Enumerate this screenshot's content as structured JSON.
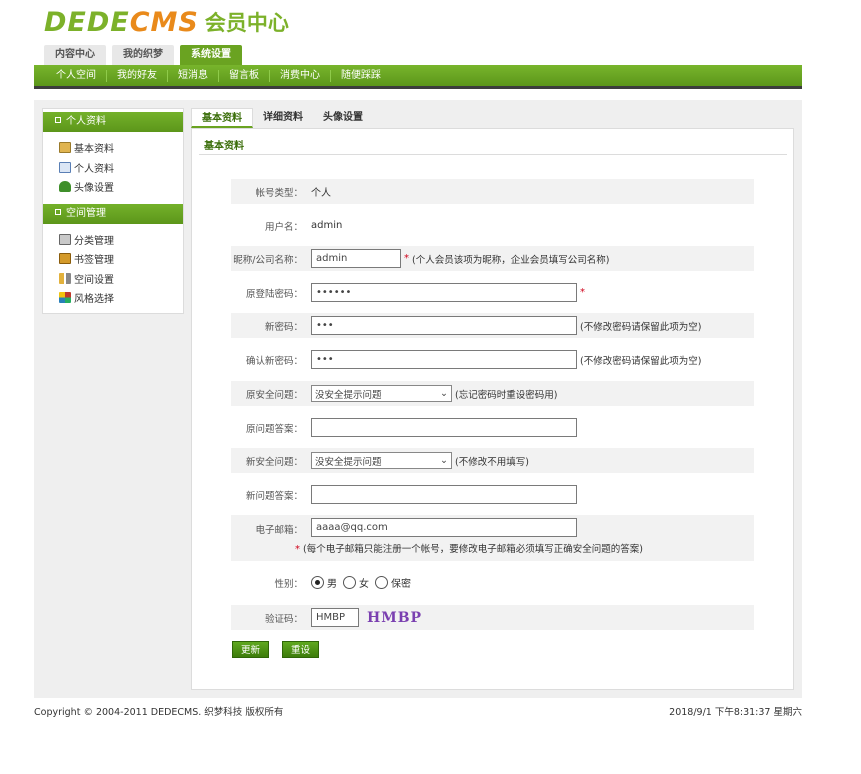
{
  "logo": {
    "text_a": "DEDE",
    "text_b": "CMS",
    "text_c": "会员中心"
  },
  "top_tabs": [
    {
      "label": "内容中心"
    },
    {
      "label": "我的织梦"
    },
    {
      "label": "系统设置"
    }
  ],
  "subnav": [
    {
      "label": "个人空间"
    },
    {
      "label": "我的好友"
    },
    {
      "label": "短消息"
    },
    {
      "label": "留言板"
    },
    {
      "label": "消费中心"
    },
    {
      "label": "随便踩踩"
    }
  ],
  "sidebar": {
    "group1": {
      "title": "个人资料",
      "items": [
        {
          "label": "基本资料"
        },
        {
          "label": "个人资料"
        },
        {
          "label": "头像设置"
        }
      ]
    },
    "group2": {
      "title": "空间管理",
      "items": [
        {
          "label": "分类管理"
        },
        {
          "label": "书签管理"
        },
        {
          "label": "空间设置"
        },
        {
          "label": "风格选择"
        }
      ]
    }
  },
  "tabs": [
    {
      "label": "基本资料"
    },
    {
      "label": "详细资料"
    },
    {
      "label": "头像设置"
    }
  ],
  "section_title": "基本资料",
  "form": {
    "account_type": {
      "label": "帐号类型：",
      "value": "个人"
    },
    "username": {
      "label": "用户名：",
      "value": "admin"
    },
    "nickname": {
      "label": "昵称/公司名称：",
      "value": "admin",
      "hint": "(个人会员该项为昵称，企业会员填写公司名称)",
      "req": "*"
    },
    "old_password": {
      "label": "原登陆密码：",
      "value": "••••••",
      "req": "*"
    },
    "new_password": {
      "label": "新密码：",
      "value": "•••",
      "hint": "(不修改密码请保留此项为空)"
    },
    "confirm_password": {
      "label": "确认新密码：",
      "value": "•••",
      "hint": "(不修改密码请保留此项为空)"
    },
    "old_question": {
      "label": "原安全问题：",
      "value": "没安全提示问题",
      "hint": "(忘记密码时重设密码用)"
    },
    "old_answer": {
      "label": "原问题答案：",
      "value": ""
    },
    "new_question": {
      "label": "新安全问题：",
      "value": "没安全提示问题",
      "hint": "(不修改不用填写)"
    },
    "new_answer": {
      "label": "新问题答案：",
      "value": ""
    },
    "email": {
      "label": "电子邮箱：",
      "value": "aaaa@qq.com",
      "req": "*",
      "note": "(每个电子邮箱只能注册一个帐号，要修改电子邮箱必须填写正确安全问题的答案)"
    },
    "gender": {
      "label": "性别：",
      "options": [
        {
          "label": "男",
          "checked": true
        },
        {
          "label": "女",
          "checked": false
        },
        {
          "label": "保密",
          "checked": false
        }
      ]
    },
    "captcha": {
      "label": "验证码：",
      "value": "HMBP",
      "image_text": "HMBP"
    }
  },
  "buttons": {
    "update": "更新",
    "reset": "重设"
  },
  "footer": {
    "copyright": "Copyright © 2004-2011 DEDECMS. 织梦科技 版权所有",
    "datetime": "2018/9/1 下午8:31:37 星期六"
  },
  "colors": {
    "primary_green": "#6aa321",
    "logo_orange": "#e98a1b",
    "required_red": "#d0021b"
  }
}
